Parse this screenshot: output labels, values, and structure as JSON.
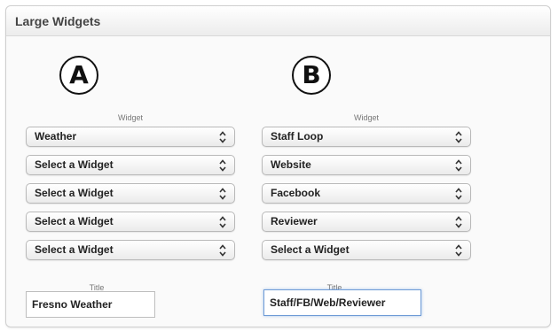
{
  "panel": {
    "title": "Large Widgets"
  },
  "columns": [
    {
      "badge": "A",
      "widget_label": "Widget",
      "selects": [
        "Weather",
        "Select a Widget",
        "Select a Widget",
        "Select a Widget",
        "Select a Widget"
      ],
      "title_label": "Title",
      "title_value": "Fresno Weather"
    },
    {
      "badge": "B",
      "widget_label": "Widget",
      "selects": [
        "Staff Loop",
        "Website",
        "Facebook",
        "Reviewer",
        "Select a Widget"
      ],
      "title_label": "Title",
      "title_value": "Staff/FB/Web/Reviewer"
    }
  ],
  "icons": {
    "select_arrows": "up-down-chevron-icon"
  },
  "colors": {
    "focus_border": "#6e9bd6",
    "panel_border": "#cfcfcf"
  }
}
